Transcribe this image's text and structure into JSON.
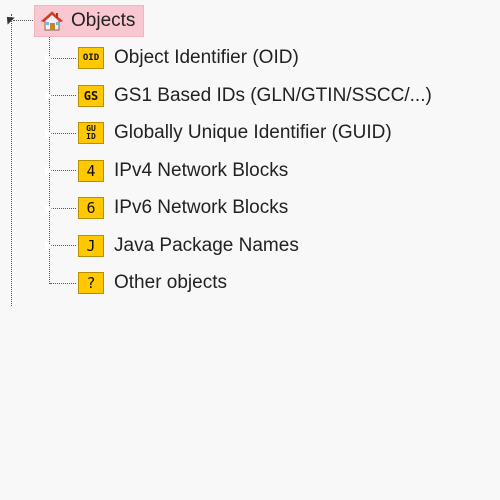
{
  "tree": {
    "root": {
      "label": "Objects",
      "icon": "house-icon"
    },
    "children": [
      {
        "label": "Object Identifier (OID)",
        "badge": "OID",
        "badge_style": "small",
        "expandable": true
      },
      {
        "label": "GS1 Based IDs (GLN/GTIN/SSCC/...)",
        "badge": "GS",
        "badge_style": "mid",
        "expandable": true
      },
      {
        "label": "Globally Unique Identifier (GUID)",
        "badge": "GU ID",
        "badge_style": "stack",
        "expandable": true
      },
      {
        "label": "IPv4 Network Blocks",
        "badge": "4",
        "badge_style": "big",
        "expandable": true
      },
      {
        "label": "IPv6 Network Blocks",
        "badge": "6",
        "badge_style": "big",
        "expandable": true
      },
      {
        "label": "Java Package Names",
        "badge": "J",
        "badge_style": "big",
        "expandable": true
      },
      {
        "label": "Other objects",
        "badge": "?",
        "badge_style": "big",
        "expandable": false
      }
    ]
  },
  "colors": {
    "background": "#f8f8f8",
    "root_highlight": "#f9c7cf",
    "badge": "#ffc800"
  }
}
